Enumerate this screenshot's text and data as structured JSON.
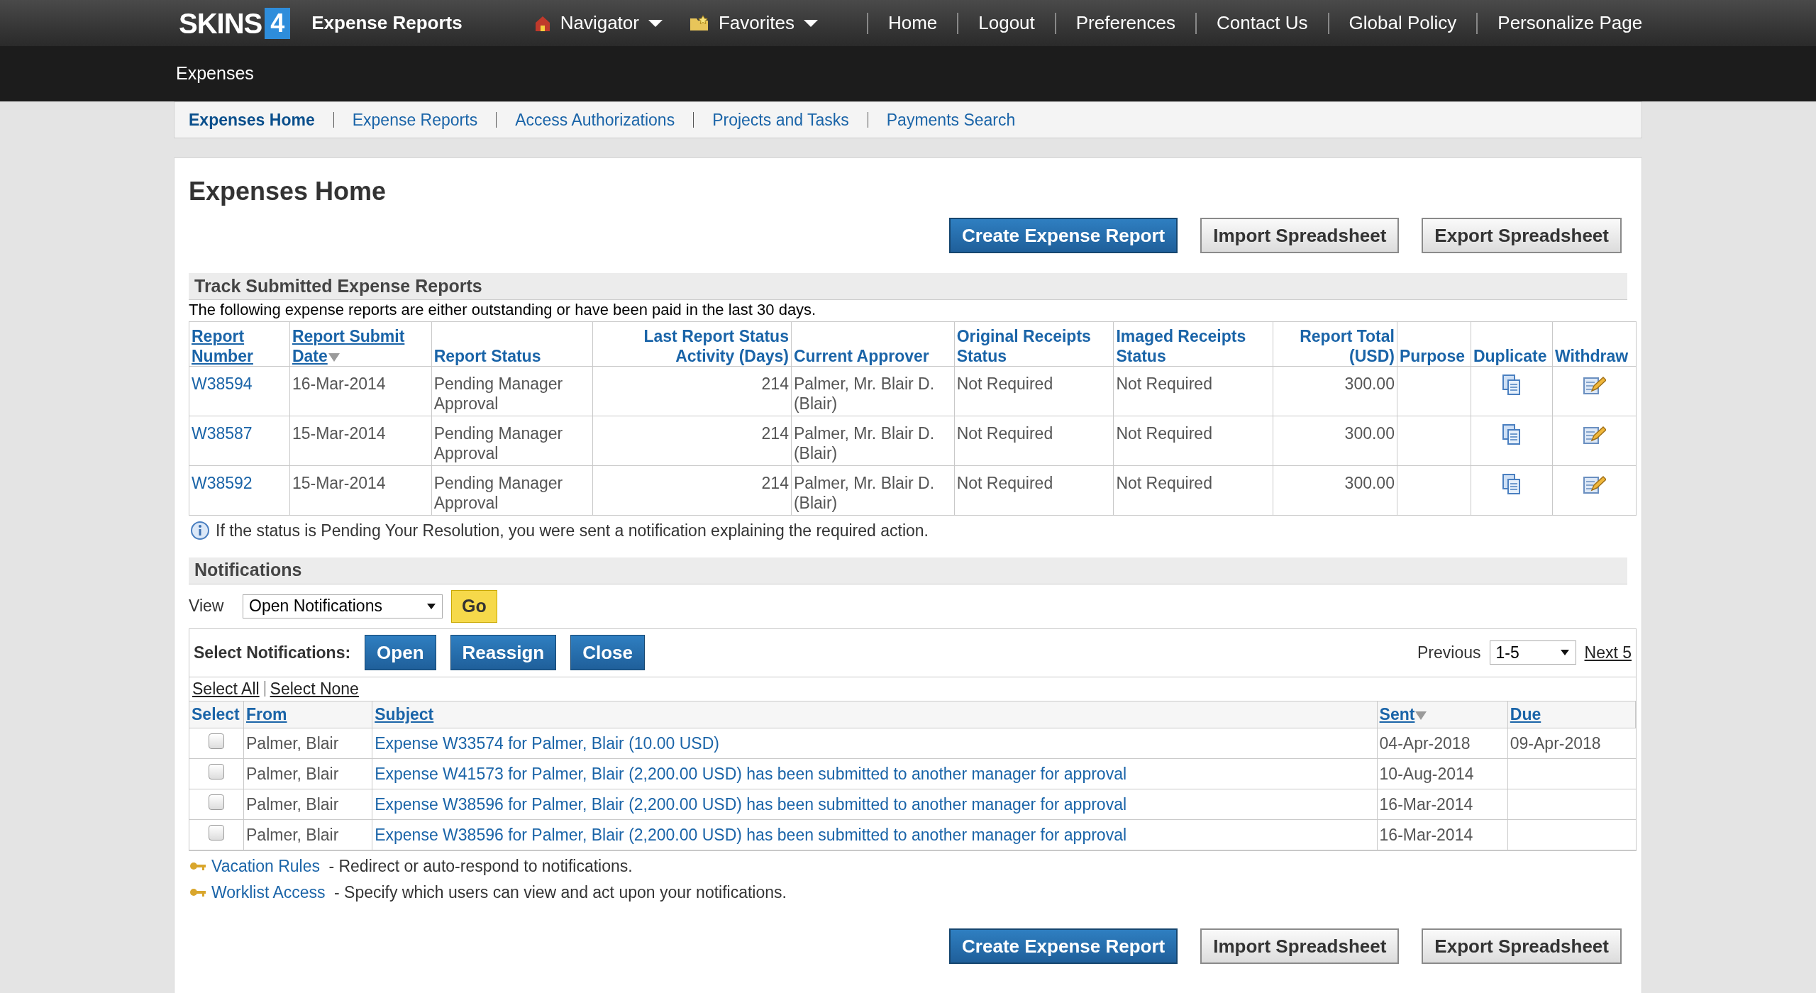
{
  "header": {
    "logo_text": "SKINS",
    "logo_badge": "4",
    "app_title": "Expense Reports",
    "menus": [
      {
        "label": "Navigator",
        "kind": "navigator"
      },
      {
        "label": "Favorites",
        "kind": "favorites"
      }
    ],
    "links": [
      "Home",
      "Logout",
      "Preferences",
      "Contact Us",
      "Global Policy",
      "Personalize Page"
    ]
  },
  "subheader": {
    "title": "Expenses"
  },
  "subnav": [
    {
      "label": "Expenses Home",
      "selected": true
    },
    {
      "label": "Expense Reports",
      "selected": false
    },
    {
      "label": "Access Authorizations",
      "selected": false
    },
    {
      "label": "Projects and Tasks",
      "selected": false
    },
    {
      "label": "Payments Search",
      "selected": false
    }
  ],
  "page_title": "Expenses Home",
  "top_buttons": [
    {
      "label": "Create Expense Report",
      "kind": "primary"
    },
    {
      "label": "Import Spreadsheet",
      "kind": "secondary"
    },
    {
      "label": "Export Spreadsheet",
      "kind": "secondary"
    }
  ],
  "reports": {
    "title": "Track Submitted Expense Reports",
    "description": "The following expense reports are either outstanding or have been paid in the last 30 days.",
    "columns": [
      {
        "label": "Report Number",
        "link": true,
        "sorted": false,
        "kind": "text"
      },
      {
        "label": "Report Submit Date",
        "link": true,
        "sorted": true,
        "kind": "text"
      },
      {
        "label": "Report Status",
        "link": false,
        "sorted": false,
        "kind": "text"
      },
      {
        "label": "Last Report Status Activity (Days)",
        "link": false,
        "sorted": false,
        "kind": "number"
      },
      {
        "label": "Current Approver",
        "link": false,
        "sorted": false,
        "kind": "text"
      },
      {
        "label": "Original Receipts Status",
        "link": false,
        "sorted": false,
        "kind": "text"
      },
      {
        "label": "Imaged Receipts Status",
        "link": false,
        "sorted": false,
        "kind": "text"
      },
      {
        "label": "Report Total (USD)",
        "link": false,
        "sorted": false,
        "kind": "number"
      },
      {
        "label": "Purpose",
        "link": false,
        "sorted": false,
        "kind": "text"
      },
      {
        "label": "Duplicate",
        "link": false,
        "sorted": false,
        "kind": "text"
      },
      {
        "label": "Withdraw",
        "link": false,
        "sorted": false,
        "kind": "text"
      }
    ],
    "rows": [
      {
        "number": "W38594",
        "date": "16-Mar-2014",
        "status": "Pending Manager Approval",
        "days": "214",
        "approver": "Palmer, Mr. Blair D. (Blair)",
        "original": "Not Required",
        "imaged": "Not Required",
        "total": "300.00"
      },
      {
        "number": "W38587",
        "date": "15-Mar-2014",
        "status": "Pending Manager Approval",
        "days": "214",
        "approver": "Palmer, Mr. Blair D. (Blair)",
        "original": "Not Required",
        "imaged": "Not Required",
        "total": "300.00"
      },
      {
        "number": "W38592",
        "date": "15-Mar-2014",
        "status": "Pending Manager Approval",
        "days": "214",
        "approver": "Palmer, Mr. Blair D. (Blair)",
        "original": "Not Required",
        "imaged": "Not Required",
        "total": "300.00"
      }
    ],
    "note": "If the status is Pending Your Resolution, you were sent a notification explaining the required action."
  },
  "notifications": {
    "title": "Notifications",
    "view_label": "View",
    "view_value": "Open Notifications",
    "go": "Go",
    "select_label": "Select Notifications:",
    "actions": [
      "Open",
      "Reassign",
      "Close"
    ],
    "previous": "Previous",
    "range": "1-5",
    "next": "Next 5",
    "select_all": "Select All",
    "select_none": "Select None",
    "columns": [
      {
        "label": "Select",
        "sorted": false
      },
      {
        "label": "From",
        "sorted": false
      },
      {
        "label": "Subject",
        "sorted": false
      },
      {
        "label": "Sent",
        "sorted": true
      },
      {
        "label": "Due",
        "sorted": false
      }
    ],
    "rows": [
      {
        "checked": false,
        "from": "Palmer, Blair",
        "subject": "Expense W33574 for Palmer, Blair (10.00 USD)",
        "sent": "04-Apr-2018",
        "due": "09-Apr-2018"
      },
      {
        "checked": false,
        "from": "Palmer, Blair",
        "subject": "Expense W41573 for Palmer, Blair (2,200.00 USD) has been submitted to another manager for approval",
        "sent": "10-Aug-2014"
      },
      {
        "checked": false,
        "from": "Palmer, Blair",
        "subject": "Expense W38596 for Palmer, Blair (2,200.00 USD) has been submitted to another manager for approval",
        "sent": "16-Mar-2014"
      },
      {
        "checked": false,
        "from": "Palmer, Blair",
        "subject": "Expense W38596 for Palmer, Blair (2,200.00 USD) has been submitted to another manager for approval",
        "sent": "16-Mar-2014"
      }
    ],
    "links": [
      {
        "label": "Vacation Rules",
        "text": " - Redirect or auto-respond to notifications."
      },
      {
        "label": "Worklist Access",
        "text": " - Specify which users can view and act upon your notifications."
      }
    ]
  },
  "bottom_buttons": [
    {
      "label": "Create Expense Report",
      "kind": "primary"
    },
    {
      "label": "Import Spreadsheet",
      "kind": "secondary"
    },
    {
      "label": "Export Spreadsheet",
      "kind": "secondary"
    }
  ]
}
